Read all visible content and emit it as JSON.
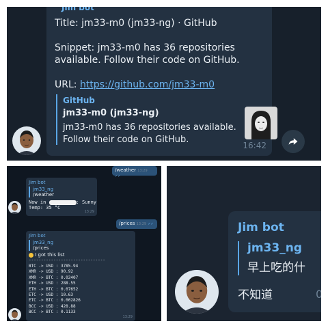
{
  "top": {
    "sender": "Jim bot",
    "title_line": "Title: jm33-m0 (jm33-ng) · GitHub",
    "snippet_line1": "Snippet: jm33-m0 has 36 repositories",
    "snippet_line2": "available. Follow their code on GitHub.",
    "url_prefix": "URL: ",
    "url_link": "https://github.com/jm33-m0",
    "preview": {
      "site": "GitHub",
      "title": "jm33-m0 (jm33-ng)",
      "desc_line1": "jm33-m0 has 36 repositories available.",
      "desc_line2": "Follow their code on GitHub."
    },
    "time": "16:42",
    "share_icon": "share-arrow-icon"
  },
  "bottom_left": {
    "out1": {
      "text": "/weather",
      "time": "13:29"
    },
    "msg1": {
      "sender": "Jim bot",
      "quote_name": "jm33_ng",
      "quote_text": "/weather",
      "line1_prefix": "Now in",
      "line1_suffix": ": Sunny",
      "line2": "Temp: 35 °C",
      "time": "13:29"
    },
    "out2": {
      "text": "/prices",
      "time": "13:29"
    },
    "msg2": {
      "sender": "Jim bot",
      "quote_name": "jm33_ng",
      "quote_text": "/prices",
      "header": "I got this list",
      "divider": "-------------------------------",
      "rows": [
        "BTC -> USD : 3785.94",
        "XMR -> USD : 90.92",
        "XMR -> BTC : 0.02407",
        "ETH -> USD : 288.55",
        "ETH -> BTC : 0.07652",
        "ETC -> USD : 10.63",
        "ETC -> BTC : 0.002826",
        "BCC -> USD : 428.88",
        "BCC -> BTC : 0.1133"
      ],
      "time": "13:29"
    }
  },
  "bottom_right": {
    "sender": "Jim bot",
    "quote_name": "jm33_ng",
    "quote_text": "早上吃的什",
    "text": "不知道",
    "time": "0"
  },
  "colors": {
    "bg_dark": "#17202b",
    "bubble": "#233141",
    "bubble_out": "#2b5278",
    "accent": "#6cb4f0",
    "text": "#e9eef3"
  }
}
